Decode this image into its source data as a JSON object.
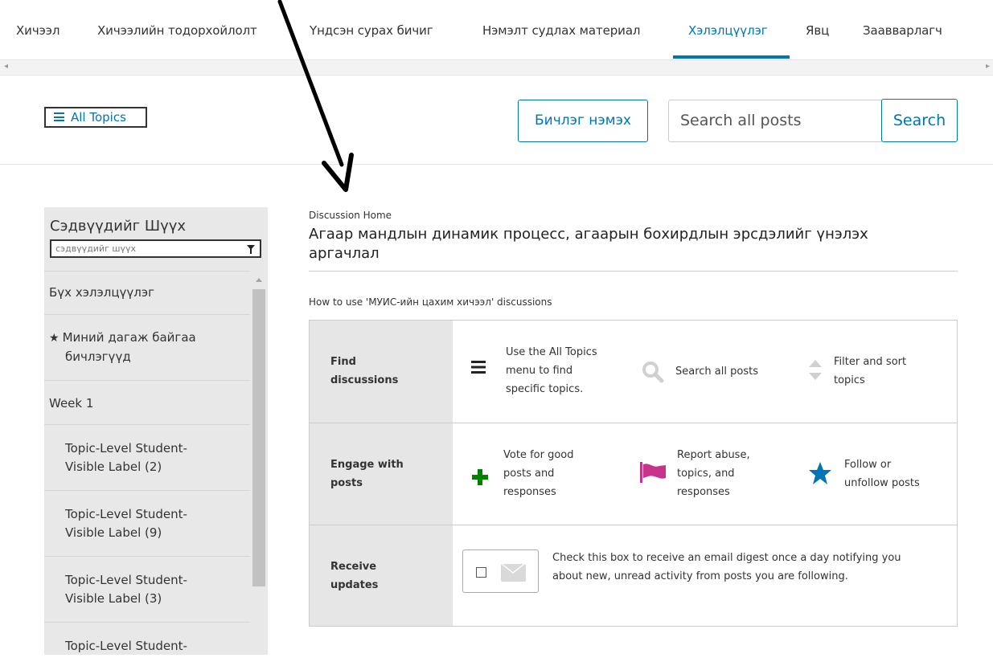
{
  "topnav": {
    "tabs": [
      {
        "label": "Хичээл"
      },
      {
        "label": "Хичээлийн тодорхойлолт"
      },
      {
        "label": "Үндсэн сурах бичиг"
      },
      {
        "label": "Нэмэлт судлах материал"
      },
      {
        "label": "Хэлэлцүүлэг",
        "active": true
      },
      {
        "label": "Явц"
      },
      {
        "label": "Заавварлагч"
      }
    ],
    "accent_color": "#0075b4"
  },
  "toolbar": {
    "all_topics_label": "All Topics",
    "add_post_label": "Бичлэг нэмэх",
    "search_value": "Search all posts",
    "search_label": "Search"
  },
  "sidebar": {
    "filter_title": "Сэдвүүдийг Шүүх",
    "filter_placeholder": "сэдвүүдийг шүүх",
    "items": [
      {
        "label": "Бүх хэлэлцүүлэг"
      },
      {
        "label_line1": "Миний дагаж байгаа",
        "label_line2": "бичлэгүүд"
      },
      {
        "label": "Week 1"
      },
      {
        "label_line1": "Topic-Level Student-",
        "label_line2": "Visible Label (2)"
      },
      {
        "label_line1": "Topic-Level Student-",
        "label_line2": "Visible Label (9)"
      },
      {
        "label_line1": "Topic-Level Student-",
        "label_line2": "Visible Label (3)"
      },
      {
        "label_line1": "Topic-Level Student-"
      }
    ]
  },
  "main": {
    "breadcrumb": "Discussion Home",
    "title_line1": "Агаар мандлын динамик процесс, агаарын бохирдлын эрсдэлийг үнэлэх",
    "title_line2": "аргачлал",
    "howto": "How to use 'МУИС-ийн цахим хичээл' discussions",
    "guide": {
      "find": {
        "label_line1": "Find",
        "label_line2": "discussions",
        "all_topics_lines": [
          "Use the All Topics",
          "menu to find",
          "specific topics."
        ],
        "search_text": "Search all posts",
        "filter_lines": [
          "Filter and sort",
          "topics"
        ]
      },
      "engage": {
        "label_line1": "Engage with",
        "label_line2": "posts",
        "vote_lines": [
          "Vote for good",
          "posts and",
          "responses"
        ],
        "report_lines": [
          "Report abuse,",
          "topics, and",
          "responses"
        ],
        "follow_lines": [
          "Follow or",
          "unfollow posts"
        ]
      },
      "receive": {
        "label_line1": "Receive",
        "label_line2": "updates",
        "digest_lines": [
          "Check this box to receive an email digest once a day notifying you",
          "about new, unread activity from posts you are following."
        ]
      }
    },
    "icon_colors": {
      "vote": "#008100",
      "report": "#c7338b",
      "follow": "#0075b4"
    }
  }
}
